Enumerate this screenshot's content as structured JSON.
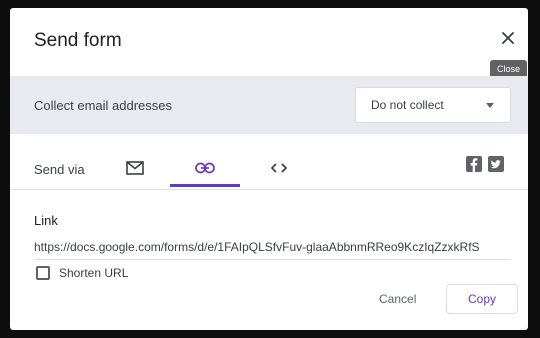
{
  "dialog": {
    "title": "Send form",
    "close_tooltip": "Close"
  },
  "collect": {
    "label": "Collect email addresses",
    "selected": "Do not collect"
  },
  "send_via": {
    "label": "Send via",
    "tabs": [
      {
        "icon": "email-icon",
        "selected": false
      },
      {
        "icon": "link-icon",
        "selected": true
      },
      {
        "icon": "embed-code-icon",
        "selected": false
      }
    ],
    "social": [
      {
        "icon": "facebook-icon"
      },
      {
        "icon": "twitter-icon"
      }
    ]
  },
  "link": {
    "heading": "Link",
    "url": "https://docs.google.com/forms/d/e/1FAIpQLSfvFuv-glaaAbbnmRReo9KczIqZzxkRfS",
    "shorten_label": "Shorten URL",
    "shorten_checked": false
  },
  "actions": {
    "cancel": "Cancel",
    "copy": "Copy"
  },
  "colors": {
    "accent": "#673ab7",
    "header_band": "#e8eaf0"
  }
}
